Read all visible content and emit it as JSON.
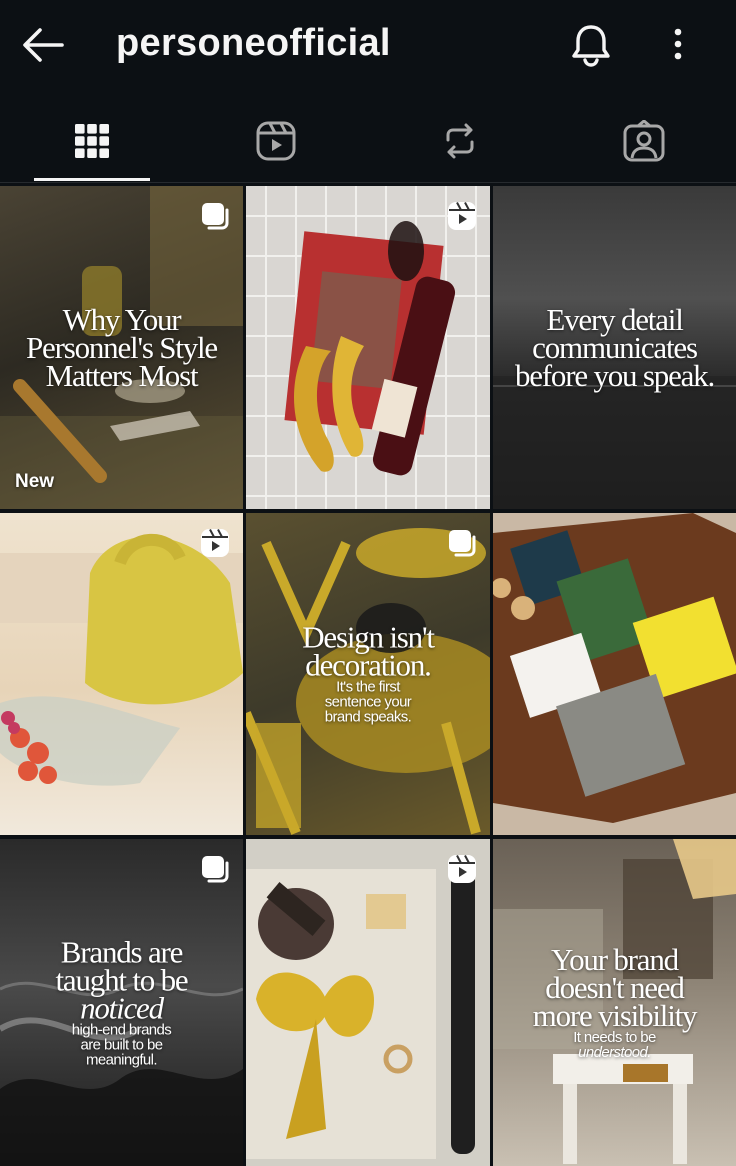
{
  "header": {
    "username": "personeofficial",
    "back_icon": "arrow-left-icon",
    "notification_icon": "bell-icon",
    "more_icon": "more-vertical-icon"
  },
  "tabs": [
    {
      "icon": "grid-icon",
      "selected": true
    },
    {
      "icon": "reels-icon",
      "selected": false
    },
    {
      "icon": "reposts-icon",
      "selected": false
    },
    {
      "icon": "tagged-icon",
      "selected": false
    }
  ],
  "posts": [
    {
      "type": "carousel",
      "badge_icon": "carousel-icon",
      "caption_lines": [
        "Why Your",
        "Personnel's Style",
        "Matters Most"
      ],
      "label": "New"
    },
    {
      "type": "reel",
      "badge_icon": "reel-icon",
      "caption_lines": []
    },
    {
      "type": "image",
      "caption_lines": [
        "Every detail",
        "communicates",
        "before you speak."
      ]
    },
    {
      "type": "reel",
      "badge_icon": "reel-icon",
      "caption_lines": []
    },
    {
      "type": "carousel",
      "badge_icon": "carousel-icon",
      "caption_lines": [
        "Design isn't",
        "decoration."
      ],
      "sub_lines": [
        "It's the first",
        "sentence your",
        "brand speaks."
      ]
    },
    {
      "type": "image",
      "caption_lines": []
    },
    {
      "type": "carousel",
      "badge_icon": "carousel-icon",
      "caption_lines": [
        "Brands are",
        "taught to be",
        "noticed"
      ],
      "sub_lines": [
        "high-end brands",
        "are built to be",
        "meaningful."
      ]
    },
    {
      "type": "reel",
      "badge_icon": "reel-icon",
      "caption_lines": []
    },
    {
      "type": "image",
      "caption_lines": [
        "Your brand",
        "doesn't need",
        "more visibility"
      ],
      "sub_lines": [
        "It needs to be",
        "understood."
      ]
    }
  ],
  "colors": {
    "background": "#0c1014",
    "text": "#f5f5f5"
  }
}
